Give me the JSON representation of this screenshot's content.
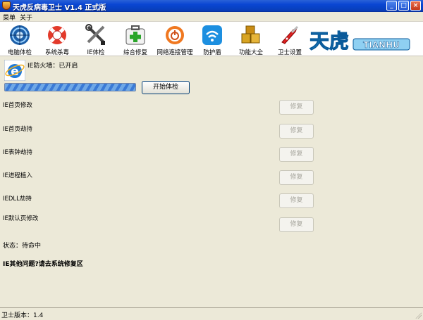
{
  "window": {
    "title": "天虎反病毒卫士 V1.4 正式版",
    "controls": {
      "minimize": "_",
      "maximize": "□",
      "close": "×"
    }
  },
  "menu": {
    "items": [
      {
        "label": "菜单"
      },
      {
        "label": "关于"
      }
    ]
  },
  "toolbar": {
    "items": [
      {
        "label": "电脑体检",
        "icon": "globe-icon"
      },
      {
        "label": "系统杀毒",
        "icon": "lifebuoy-icon"
      },
      {
        "label": "IE体检",
        "icon": "tools-icon"
      },
      {
        "label": "综合修复",
        "icon": "medkit-icon"
      },
      {
        "label": "网络连接管理",
        "icon": "power-icon"
      },
      {
        "label": "防护盾",
        "icon": "wifi-icon"
      },
      {
        "label": "功能大全",
        "icon": "blocks-icon"
      },
      {
        "label": "卫士设置",
        "icon": "knife-icon"
      }
    ],
    "logo": {
      "text": "天虎",
      "sub": "TIANHU"
    }
  },
  "main": {
    "firewall_status": "IE防火墙：已开启",
    "progress": 1.0,
    "scan_button": "开始体检",
    "checks": [
      {
        "label": "IE首页修改",
        "fix": "修复"
      },
      {
        "label": "IE首页劫持",
        "fix": "修复"
      },
      {
        "label": "IE表钟劫持",
        "fix": "修复"
      },
      {
        "label": "IE进程植入",
        "fix": "修复"
      },
      {
        "label": "IEDLL劫持",
        "fix": "修复"
      },
      {
        "label": "IE默认页修改",
        "fix": "修复"
      }
    ],
    "status": "状态：待命中",
    "hint": "IE其他问题?请去系统修复区"
  },
  "statusbar": {
    "version": "卫士版本：1.4"
  },
  "colors": {
    "titlebar": "#0a46d2",
    "accent": "#3a7ad6",
    "background": "#ece9d8"
  }
}
